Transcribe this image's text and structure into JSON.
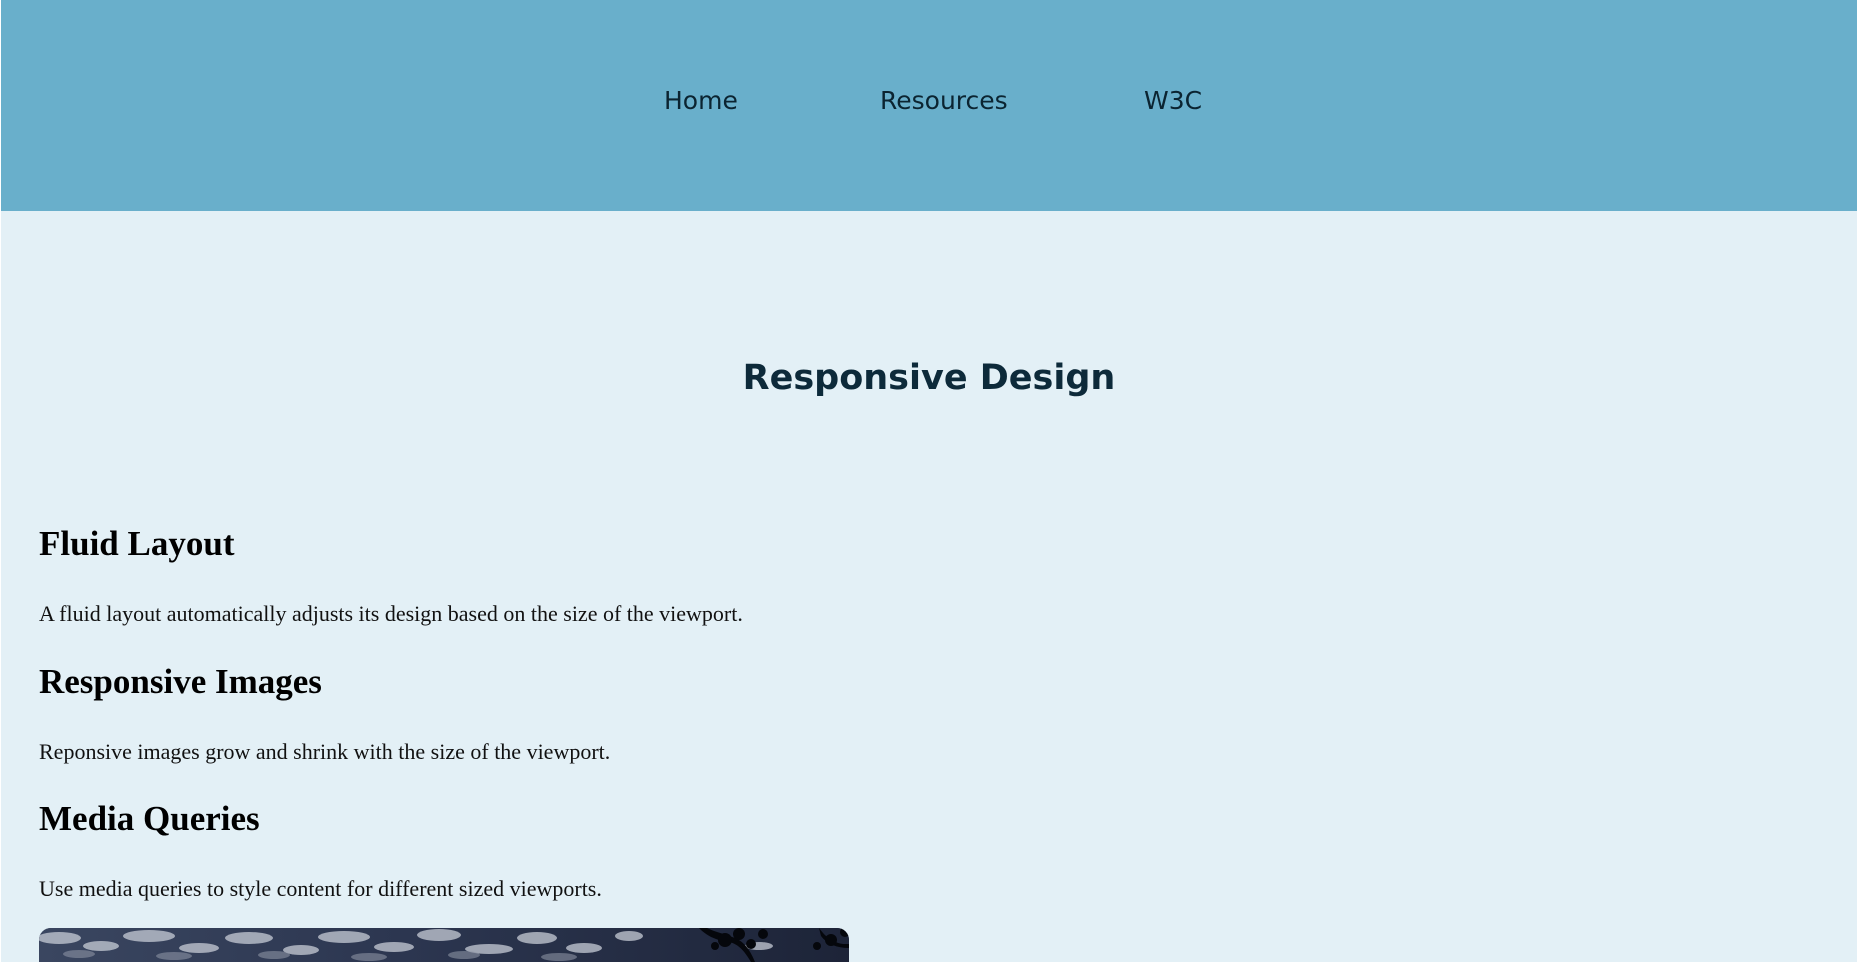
{
  "nav": {
    "items": [
      {
        "label": "Home"
      },
      {
        "label": "Resources"
      },
      {
        "label": "W3C"
      }
    ]
  },
  "page_title": "Responsive Design",
  "sections": [
    {
      "heading": "Fluid Layout",
      "text": "A fluid layout automatically adjusts its design based on the size of the viewport."
    },
    {
      "heading": "Responsive Images",
      "text": "Reponsive images grow and shrink with the size of the viewport."
    },
    {
      "heading": "Media Queries",
      "text": "Use media queries to style content for different sized viewports."
    }
  ],
  "colors": {
    "nav_background": "#69afcb",
    "page_background": "#e3f0f6",
    "nav_text": "#0b2431",
    "title_text": "#0d2a3a"
  }
}
